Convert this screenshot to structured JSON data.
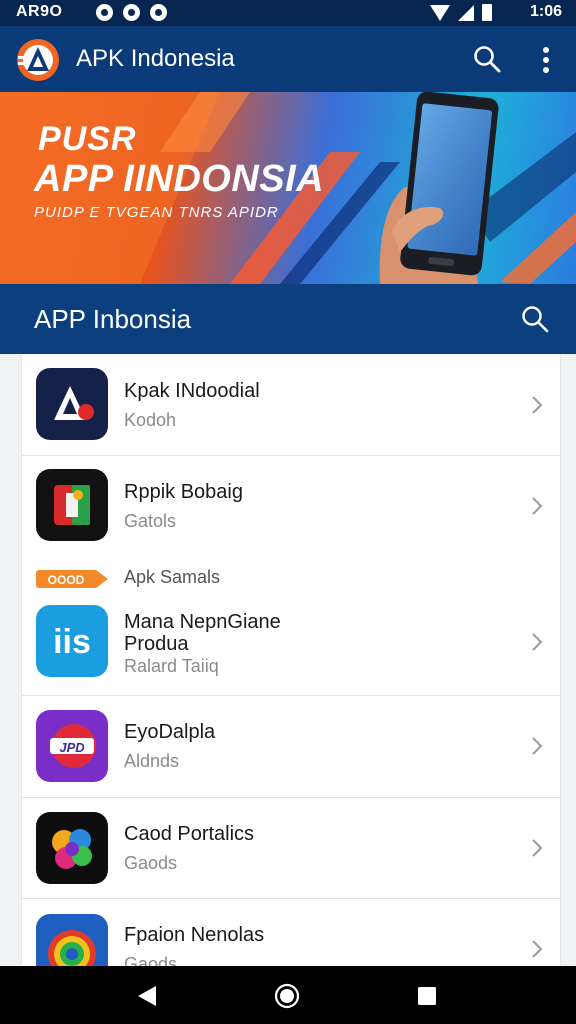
{
  "status_bar": {
    "left_text": "AR9O",
    "time": "1:06"
  },
  "app_bar": {
    "title": "APK Indonesia"
  },
  "banner": {
    "line1": "PUSR",
    "line2": "APP IINDONSIA",
    "line3": "PUIDP E TVGEAN TNRS APIDR"
  },
  "section": {
    "title": "APP Inbonsia"
  },
  "apps": [
    {
      "title": "Kpak INdoodial",
      "subtitle": "Kodoh"
    },
    {
      "title": "Rppik Bobaig",
      "subtitle": "Gatols"
    },
    {
      "title": "Mana  NepnGiane\nProdua",
      "subtitle": "Ralard Taiiq"
    },
    {
      "title": "EyoDalpla",
      "subtitle": "Aldnds"
    },
    {
      "title": "Caod Portalics",
      "subtitle": "Gaods"
    },
    {
      "title": "Fpaion Nenolas",
      "subtitle": "Gaods"
    }
  ],
  "sub_item": {
    "badge": "OOOD",
    "label": "Apk Samals"
  },
  "colors": {
    "status_bar": "#06264f",
    "app_bar": "#0a3a78",
    "section": "#0b3f7e",
    "accent_orange": "#f26522"
  }
}
